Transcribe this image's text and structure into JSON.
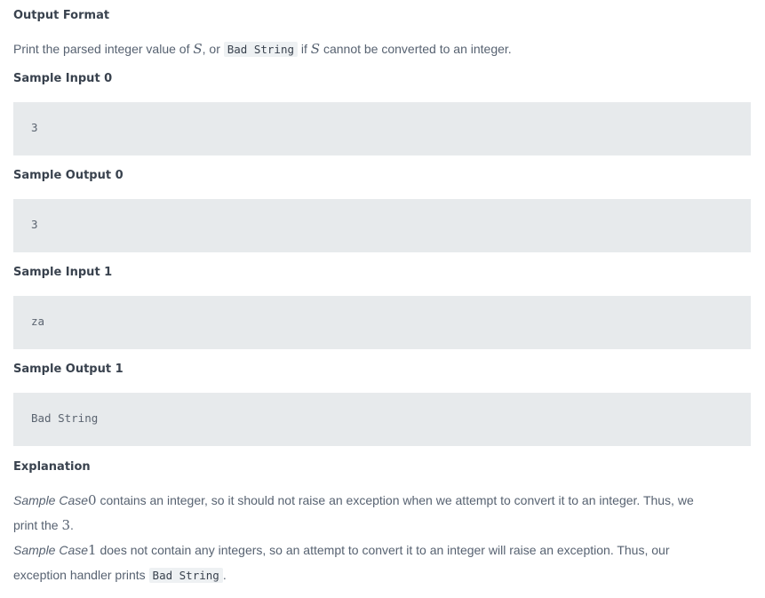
{
  "output_format": {
    "heading": "Output Format",
    "text_before": "Print the parsed integer value of ",
    "var_s": "S",
    "text_or": ", or ",
    "bad_string": "Bad String",
    "text_if": " if ",
    "var_s2": "S",
    "text_after": " cannot be converted to an integer."
  },
  "samples": [
    {
      "heading": "Sample Input 0",
      "value": "3"
    },
    {
      "heading": "Sample Output 0",
      "value": "3"
    },
    {
      "heading": "Sample Input 1",
      "value": "za"
    },
    {
      "heading": "Sample Output 1",
      "value": "Bad String"
    }
  ],
  "explanation": {
    "heading": "Explanation",
    "line1_case": "Sample Case",
    "line1_num": "0",
    "line1_text": " contains an integer, so it should not raise an exception when we attempt to convert it to an integer. Thus, we",
    "line2_text": "print the ",
    "line2_num": "3",
    "line2_end": ".",
    "line3_case": "Sample Case",
    "line3_num": "1",
    "line3_text": " does not contain any integers, so an attempt to convert it to an integer will raise an exception. Thus, our",
    "line4_text": "exception handler prints ",
    "line4_code": "Bad String",
    "line4_end": "."
  }
}
